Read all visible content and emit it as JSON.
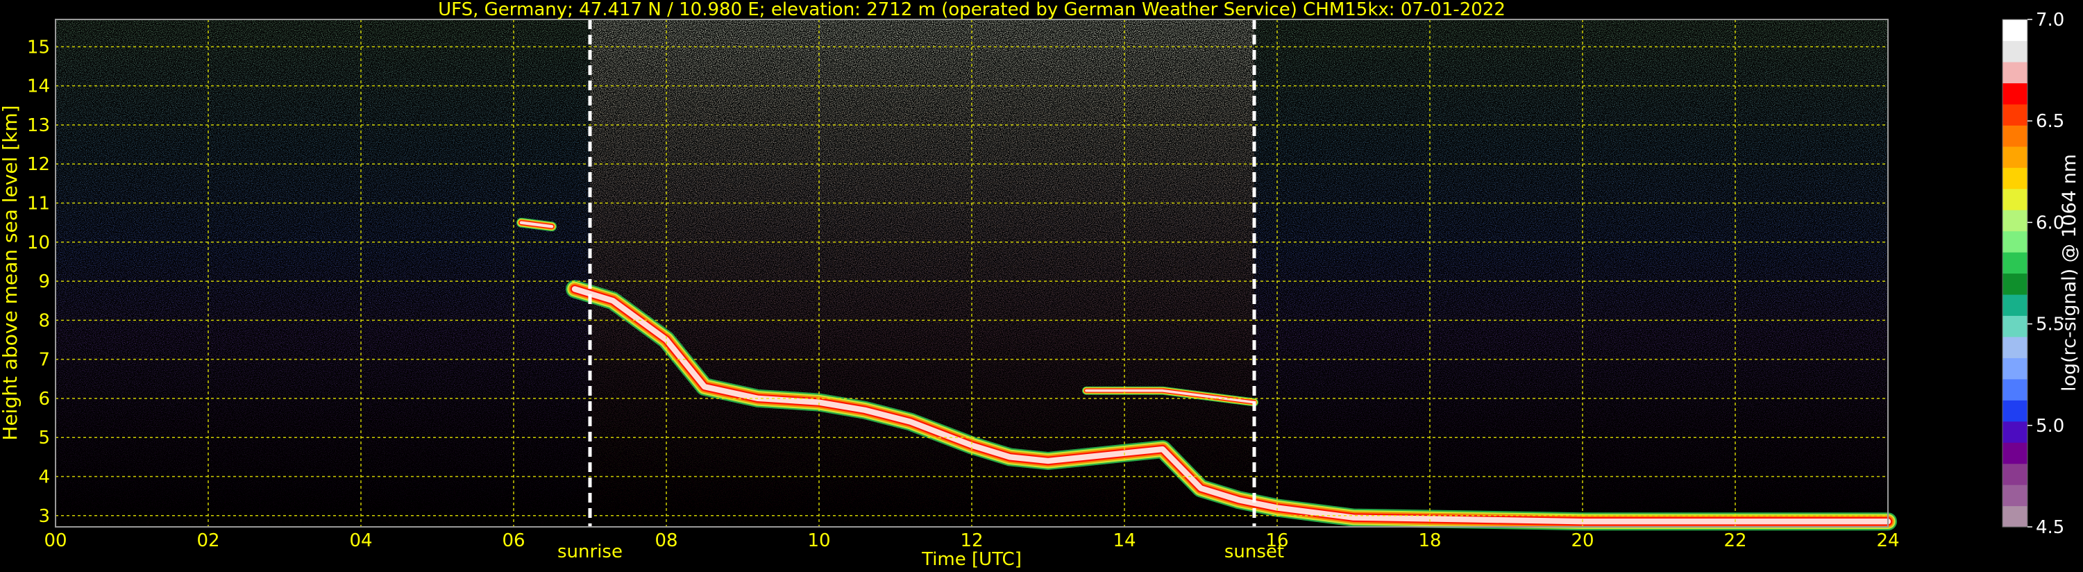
{
  "chart_data": {
    "type": "heatmap",
    "title": "UFS, Germany; 47.417 N / 10.980 E; elevation: 2712 m  (operated by German Weather Service)    CHM15kx: 07-01-2022",
    "xlabel": "Time [UTC]",
    "ylabel": "Height above mean sea level [km]",
    "xlim": [
      0,
      24
    ],
    "ylim": [
      2.712,
      15.7
    ],
    "x_ticks": [
      "00",
      "02",
      "04",
      "06",
      "08",
      "10",
      "12",
      "14",
      "16",
      "18",
      "20",
      "22",
      "24"
    ],
    "y_ticks": [
      "3",
      "4",
      "5",
      "6",
      "7",
      "8",
      "9",
      "10",
      "11",
      "12",
      "13",
      "14",
      "15"
    ],
    "grid": true,
    "colorbar": {
      "label": "log(rc-signal) @ 1064 nm",
      "range": [
        4.5,
        7.0
      ],
      "ticks": [
        "4.5",
        "5.0",
        "5.5",
        "6.0",
        "6.5",
        "7.0"
      ]
    },
    "markers": [
      {
        "label": "sunrise",
        "x": 7.0
      },
      {
        "label": "sunset",
        "x": 15.7
      }
    ],
    "layers": [
      {
        "name": "cloud",
        "points": [
          [
            6.8,
            8.8
          ],
          [
            7.3,
            8.5
          ],
          [
            8.0,
            7.5
          ],
          [
            8.5,
            6.3
          ],
          [
            9.2,
            6.0
          ],
          [
            10.0,
            5.9
          ],
          [
            10.6,
            5.7
          ],
          [
            11.2,
            5.4
          ],
          [
            12.0,
            4.8
          ],
          [
            12.5,
            4.5
          ],
          [
            13.0,
            4.4
          ],
          [
            13.5,
            4.5
          ],
          [
            14.0,
            4.6
          ],
          [
            14.5,
            4.7
          ],
          [
            15.0,
            3.7
          ],
          [
            15.5,
            3.4
          ],
          [
            16.0,
            3.2
          ],
          [
            17.0,
            2.95
          ],
          [
            18.5,
            2.9
          ],
          [
            20.0,
            2.85
          ],
          [
            22.0,
            2.85
          ],
          [
            24.0,
            2.85
          ]
        ]
      },
      {
        "name": "cloud top",
        "points": [
          [
            13.5,
            6.2
          ],
          [
            14.5,
            6.2
          ],
          [
            15.7,
            5.9
          ]
        ]
      },
      {
        "name": "high cloud",
        "points": [
          [
            6.1,
            10.5
          ],
          [
            6.5,
            10.4
          ]
        ]
      }
    ]
  },
  "colors": {
    "background": "#000000",
    "text": "#ffff00",
    "grid": "#e6e600",
    "colorbar_stops": [
      "#ae8fa6",
      "#9a5f9a",
      "#8a3a8e",
      "#72008f",
      "#4c0cc0",
      "#1f3ff2",
      "#4d7bff",
      "#7da5ff",
      "#9fbdf2",
      "#6ad6c0",
      "#17b08a",
      "#0f8f2c",
      "#2bc653",
      "#7ef07f",
      "#b4f57a",
      "#e8f232",
      "#ffd200",
      "#ffa500",
      "#ff7a00",
      "#ff3b00",
      "#ff0000",
      "#f3b4b4",
      "#e6e6e6",
      "#ffffff"
    ]
  }
}
